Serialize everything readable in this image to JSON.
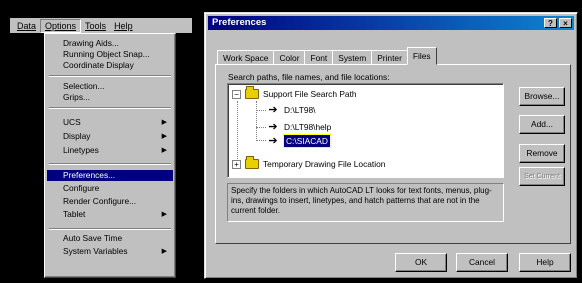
{
  "menubar": {
    "items": [
      "Data",
      "Options",
      "Tools",
      "Help"
    ]
  },
  "options_menu": {
    "items": [
      {
        "label": "Drawing Aids..."
      },
      {
        "label": "Running Object Snap..."
      },
      {
        "label": "Coordinate Display"
      },
      {
        "label": "Selection..."
      },
      {
        "label": "Grips..."
      },
      {
        "label": "UCS",
        "submenu": true
      },
      {
        "label": "Display",
        "submenu": true
      },
      {
        "label": "Linetypes",
        "submenu": true
      },
      {
        "label": "Preferences...",
        "selected": true
      },
      {
        "label": "Configure"
      },
      {
        "label": "Render Configure..."
      },
      {
        "label": "Tablet",
        "submenu": true
      },
      {
        "label": "Auto Save Time"
      },
      {
        "label": "System Variables",
        "submenu": true
      }
    ]
  },
  "dialog": {
    "title": "Preferences",
    "help_btn": "?",
    "close_btn": "×",
    "tabs": [
      "Work Space",
      "Color",
      "Font",
      "System",
      "Printer",
      "Files"
    ],
    "active_tab": "Files",
    "panel_label": "Search paths, file names, and file locations:",
    "tree": {
      "root": "Support File Search Path",
      "children": [
        "D:\\LT98\\",
        "D:\\LT98\\help",
        "C:\\SIACAD"
      ],
      "selected": "C:\\SIACAD",
      "next_root": "Temporary Drawing File Location"
    },
    "buttons": {
      "browse": "Browse...",
      "add": "Add...",
      "remove": "Remove",
      "set_current": "Set Current"
    },
    "description": "Specify the folders in which AutoCAD LT looks for text fonts, menus, plug-ins, drawings to insert, linetypes, and hatch patterns that are not in the current folder.",
    "footer": {
      "ok": "OK",
      "cancel": "Cancel",
      "help": "Help"
    }
  },
  "colors": {
    "face": "#c0c0c0",
    "selection": "#000080",
    "title_gradient_start": "#000080",
    "title_gradient_end": "#1084d0"
  }
}
